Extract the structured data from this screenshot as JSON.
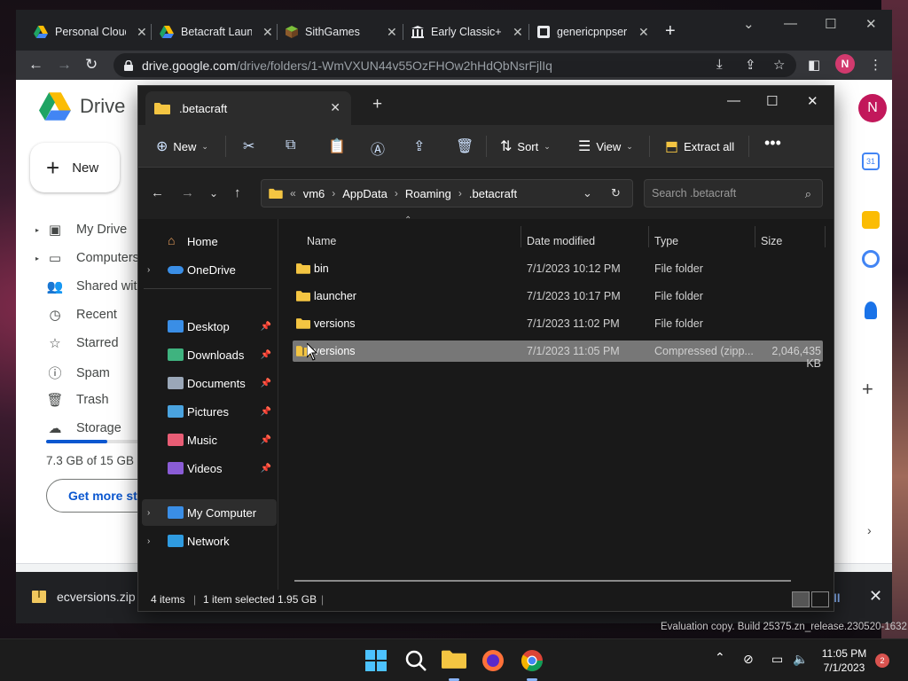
{
  "browser": {
    "tabs": [
      {
        "title": "Personal Cloud",
        "icon": "google-drive-icon"
      },
      {
        "title": "Betacraft Laun",
        "icon": "google-drive-icon"
      },
      {
        "title": "SithGames",
        "icon": "minecraft-block-icon"
      },
      {
        "title": "Early Classic+",
        "icon": "archive-building-icon"
      },
      {
        "title": "genericpnpser",
        "icon": "github-icon"
      }
    ],
    "url_host": "drive.google.com",
    "url_path": "/drive/folders/1-WmVXUN44v55OzFHOw2hHdQbNsrFjlIq",
    "profile_initial": "N",
    "accent": "#8ab4f8"
  },
  "drive": {
    "product": "Drive",
    "new_label": "New",
    "nav": [
      {
        "label": "My Drive",
        "icon": "my-drive-icon",
        "expandable": true
      },
      {
        "label": "Computers",
        "icon": "computer-icon",
        "expandable": true
      },
      {
        "label": "Shared with",
        "icon": "shared-icon",
        "expandable": false
      },
      {
        "label": "Recent",
        "icon": "clock-icon",
        "expandable": false
      },
      {
        "label": "Starred",
        "icon": "star-icon",
        "expandable": false
      },
      {
        "label": "Spam",
        "icon": "spam-icon",
        "expandable": false
      },
      {
        "label": "Trash",
        "icon": "trash-icon",
        "expandable": false
      },
      {
        "label": "Storage",
        "icon": "cloud-icon",
        "expandable": false
      }
    ],
    "storage_text": "7.3 GB of 15 GB u",
    "storage_fraction": 0.49,
    "get_more_label": "Get more st",
    "avatar_initial": "N"
  },
  "download_shelf": {
    "filename": "ecversions.zip",
    "show_all": "all"
  },
  "explorer": {
    "tab_title": ".betacraft",
    "toolbar": {
      "new": "New",
      "sort": "Sort",
      "view": "View",
      "extract_all": "Extract all"
    },
    "address": {
      "overflow": "«",
      "crumbs": [
        "vm6",
        "AppData",
        "Roaming",
        ".betacraft"
      ]
    },
    "search_placeholder": "Search .betacraft",
    "nav_pane": {
      "home": "Home",
      "onedrive": "OneDrive",
      "quick_access": [
        {
          "label": "Desktop",
          "icon": "desktop-icon",
          "color": "#3a8ee6"
        },
        {
          "label": "Downloads",
          "icon": "download-icon",
          "color": "#3fb37f"
        },
        {
          "label": "Documents",
          "icon": "documents-icon",
          "color": "#9aa7b8"
        },
        {
          "label": "Pictures",
          "icon": "pictures-icon",
          "color": "#4aa3df"
        },
        {
          "label": "Music",
          "icon": "music-icon",
          "color": "#e85d75"
        },
        {
          "label": "Videos",
          "icon": "videos-icon",
          "color": "#8a5cd6"
        }
      ],
      "my_computer": "My Computer",
      "network": "Network"
    },
    "columns": {
      "name": "Name",
      "date": "Date modified",
      "type": "Type",
      "size": "Size"
    },
    "files": [
      {
        "name": "bin",
        "date": "7/1/2023 10:12 PM",
        "type": "File folder",
        "size": "",
        "kind": "folder",
        "selected": false
      },
      {
        "name": "launcher",
        "date": "7/1/2023 10:17 PM",
        "type": "File folder",
        "size": "",
        "kind": "folder",
        "selected": false
      },
      {
        "name": "versions",
        "date": "7/1/2023 11:02 PM",
        "type": "File folder",
        "size": "",
        "kind": "folder",
        "selected": false
      },
      {
        "name": "versions",
        "date": "7/1/2023 11:05 PM",
        "type": "Compressed (zipp...",
        "size": "2,046,435 KB",
        "kind": "zip",
        "selected": true
      }
    ],
    "status": {
      "items": "4 items",
      "selected": "1 item selected  1.95 GB"
    }
  },
  "taskbar": {
    "time": "11:05 PM",
    "date": "7/1/2023",
    "notifications": "2",
    "watermark": "Evaluation copy. Build 25375.zn_release.230520-1632"
  }
}
